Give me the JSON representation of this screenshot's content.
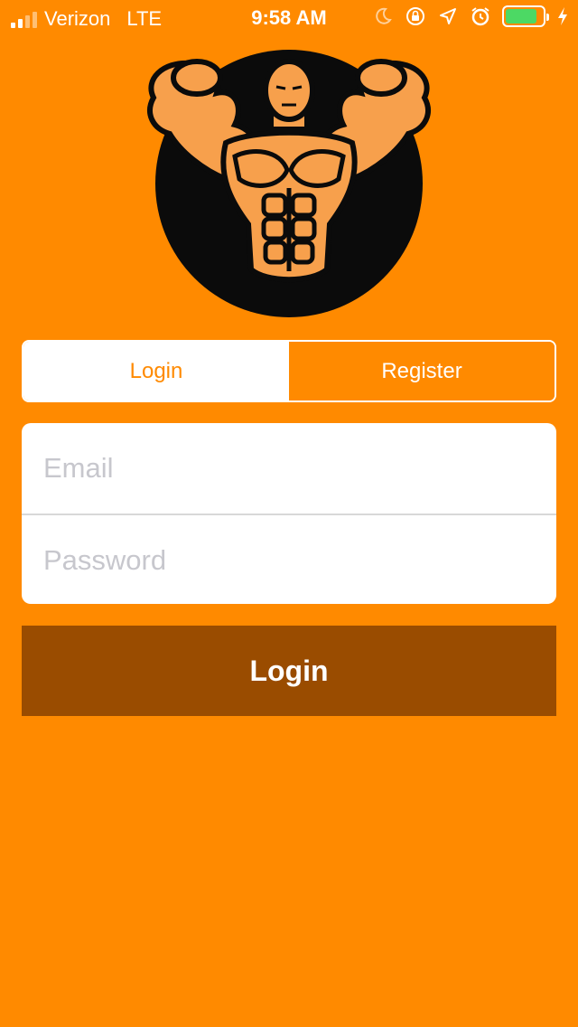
{
  "status_bar": {
    "carrier": "Verizon",
    "network": "LTE",
    "time": "9:58 AM",
    "icons": [
      "moon-icon",
      "rotation-lock-icon",
      "location-arrow-icon",
      "alarm-icon",
      "battery-icon",
      "charging-bolt-icon"
    ],
    "battery_level": 0.85,
    "battery_color": "#4CD964"
  },
  "logo": {
    "icon": "bodybuilder-logo"
  },
  "auth_tabs": {
    "login_label": "Login",
    "register_label": "Register",
    "selected": "login"
  },
  "form": {
    "email_placeholder": "Email",
    "email_value": "",
    "password_placeholder": "Password",
    "password_value": ""
  },
  "submit": {
    "label": "Login"
  },
  "colors": {
    "background": "#FF8A00",
    "button": "#9A4C00",
    "text_light": "#FFFFFF",
    "placeholder": "#C7C7CD"
  }
}
